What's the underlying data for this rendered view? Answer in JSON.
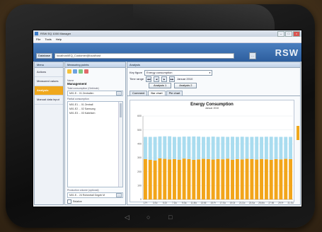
{
  "app": {
    "title": "RSW EQ 1000 Manager",
    "menu": [
      "File",
      "Tools",
      "Help"
    ],
    "database_label": "Database",
    "database_value": "localhost\\EQ_Customer@localhost",
    "logo": "RSW"
  },
  "menu_panel": {
    "title": "Menu",
    "items": [
      {
        "label": "Actions",
        "active": false
      },
      {
        "label": "Measured values",
        "active": false
      },
      {
        "label": "Analysis",
        "active": true
      },
      {
        "label": "Manual data input",
        "active": false
      }
    ]
  },
  "measuring_points": {
    "title": "Measuring points",
    "name_label": "Name",
    "name_value": "Management",
    "total_label": "Total consumption (Gebinde)",
    "total_value": "M01.E... 01 Zentrallen",
    "partial_label": "Partial consumption",
    "partial_items": [
      "M01.E1 ... 01 Zentrall",
      "M01.E2 ... 02 Samsung",
      "M01.E3 ... 03 Kabelsen"
    ],
    "production_label": "Production volume (optional)",
    "production_value": "M01.E... 24 Rohmetall Gegeb M",
    "relative_label": "Relative"
  },
  "analysis": {
    "title": "Analysis",
    "key_figure_label": "Key figure",
    "key_figure_value": "Energy consumption",
    "time_range_label": "Time range",
    "time_range_value": "Januar 2010",
    "buttons": [
      "Analysis 1",
      "Analysis 2"
    ],
    "tabs": [
      {
        "label": "Comment",
        "active": false
      },
      {
        "label": "Bar chart",
        "active": true
      },
      {
        "label": "Pie chart",
        "active": false
      }
    ]
  },
  "chart_data": {
    "type": "bar",
    "title": "Energy Consumption",
    "subtitle": "Januar 2010",
    "stacked": true,
    "ylim": [
      0,
      600
    ],
    "y_ticks": [
      "600",
      "500",
      "400",
      "300",
      "200",
      "100",
      "0"
    ],
    "x_tick_labels": [
      "1.Fr",
      "3.So",
      "5.Di",
      "7.Do",
      "9.Sa",
      "11.Mo",
      "13.Mi",
      "15.Fr",
      "17.So",
      "19.Di",
      "21.Do",
      "23.Sa",
      "25.Mo",
      "27.Mi",
      "29.Fr",
      "31.So"
    ],
    "categories": [
      "1",
      "2",
      "3",
      "4",
      "5",
      "6",
      "7",
      "8",
      "9",
      "10",
      "11",
      "12",
      "13",
      "14",
      "15",
      "16",
      "17",
      "18",
      "19",
      "20",
      "21",
      "22",
      "23",
      "24",
      "25",
      "26",
      "27",
      "28",
      "29",
      "30",
      "31"
    ],
    "series": [
      {
        "values": [
          290,
          285,
          280,
          295,
          292,
          288,
          290,
          286,
          294,
          290,
          285,
          288,
          292,
          290,
          287,
          291,
          289,
          293,
          286,
          290,
          288,
          292,
          290,
          287,
          291,
          289,
          285,
          290,
          288,
          292,
          290
        ]
      },
      {
        "values": [
          160,
          165,
          170,
          158,
          162,
          166,
          160,
          164,
          158,
          162,
          168,
          164,
          158,
          160,
          165,
          159,
          162,
          157,
          165,
          160,
          163,
          158,
          160,
          164,
          159,
          162,
          166,
          160,
          162,
          158,
          160
        ]
      }
    ],
    "colors": [
      "#f2a51a",
      "#a9dcef"
    ]
  }
}
